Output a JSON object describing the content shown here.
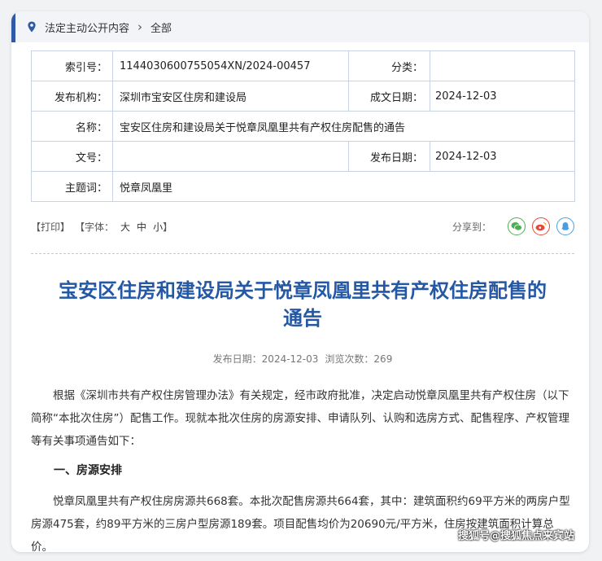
{
  "breadcrumb": {
    "item1": "法定主动公开内容",
    "sep": "›",
    "item2": "全部"
  },
  "meta": {
    "index_label": "索引号：",
    "index_value": "11440306007550​54XN/2024-00457",
    "category_label": "分类：",
    "category_value": "",
    "publisher_label": "发布机构：",
    "publisher_value": "深圳市宝安区住房和建设局",
    "written_date_label": "成文日期：",
    "written_date_value": "2024-12-03",
    "name_label": "名称：",
    "name_value": "宝安区住房和建设局关于悦章凤凰里共有产权住房配售的通告",
    "doc_no_label": "文号：",
    "doc_no_value": "",
    "publish_date_label": "发布日期：",
    "publish_date_value": "2024-12-03",
    "subject_label": "主题词：",
    "subject_value": "悦章凤凰里"
  },
  "tools": {
    "print": "【打印】",
    "font_label": "【字体：",
    "font_large": "大",
    "font_medium": "中",
    "font_small": "小",
    "font_close": "】",
    "share_label": "分享到："
  },
  "article": {
    "title_line1": "宝安区住房和建设局关于悦章凤凰里共有产权住房配售的",
    "title_line2": "通告",
    "publish_info": "发布日期：2024-12-03",
    "views_info": "浏览次数：269",
    "para1": "根据《深圳市共有产权住房管理办法》有关规定，经市政府批准，决定启动悦章凤凰里共有产权住房（以下简称“本批次住房”）配售工作。现就本批次住房的房源安排、申请队列、认购和选房方式、配售程序、产权管理等有关事项通告如下：",
    "section1": "一、房源安排",
    "para2": "悦章凤凰里共有产权住房房源共668套。本批次配售房源共664套，其中：建筑面积约69平方米的两房户型房源475套，约89平方米的三房户型房源189套。项目配售均价为20690元/平方米，住房按建筑面积计算总价。"
  },
  "watermark": "搜狐号@搜狐焦点来宾站",
  "colors": {
    "accent": "#2f5aa8",
    "title": "#2458a5",
    "wechat": "#4caf50",
    "weibo": "#e5493a",
    "qq": "#4a9ee0"
  },
  "icons": {
    "location": "location-pin-icon",
    "wechat": "wechat-icon",
    "weibo": "weibo-icon",
    "qq": "qq-icon"
  }
}
